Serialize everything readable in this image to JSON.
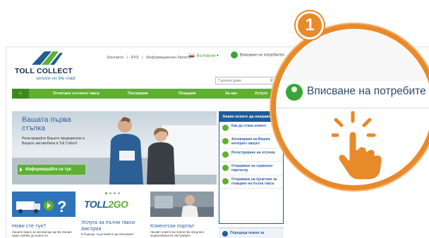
{
  "logo": {
    "name": "TOLL COLLECT",
    "tagline": "service on the road"
  },
  "toplinks": [
    "Контакти",
    "|",
    "RSS",
    "|",
    "Информационен бюлетин"
  ],
  "language": {
    "selected": "Български"
  },
  "login": {
    "label": "Вписване на потребител"
  },
  "search": {
    "placeholder": "Търсене думи"
  },
  "nav": {
    "home_icon": "home-icon",
    "items": [
      "Отчитане пътната такса",
      "Ползуване",
      "Плащане",
      "За нас",
      "Услуги"
    ]
  },
  "hero": {
    "title_line1": "Вашата първа",
    "title_line2": "стъпка",
    "subtitle": "Регистрирайте Вашето предприятие и Вашите автомобили в Toll Collect!",
    "cta": "Информирайте се тук"
  },
  "sidepanel": {
    "title": "Какво искате да направите?",
    "items": [
      {
        "label": "Как да стана клиент",
        "icon": "truck-icon"
      },
      {
        "label": "Активиране на Вашия интернет акаунт",
        "icon": "check-icon"
      },
      {
        "label": "Регистриране на отсечка",
        "icon": "document-icon"
      },
      {
        "label": "Откриване на сервизен партньор",
        "icon": "download-icon"
      },
      {
        "label": "Откриване на пунктове за плащане на пътна такса",
        "icon": "location-icon"
      }
    ],
    "faq": "Поредица пемни за"
  },
  "cards": [
    {
      "title": "Нови сте тук?",
      "text": "Нашите видео за начинаещи ще Ви покаже какво трябва да знаете за"
    },
    {
      "title": "Услуга за пътни такси Австрия",
      "text": "В бъдеще също можете да изплащате",
      "logo_a": "TOLL",
      "logo_b": "2GO"
    },
    {
      "title": "Клиентски портал",
      "text": "Нашият клиентски портал Ви предлага широкообхватно обслужване."
    }
  ],
  "magnifier": {
    "label": "Вписване на потребите"
  },
  "badge": {
    "number": "1"
  },
  "colors": {
    "accent": "#e8892a",
    "green": "#5eb030",
    "blue": "#1f5c99"
  }
}
